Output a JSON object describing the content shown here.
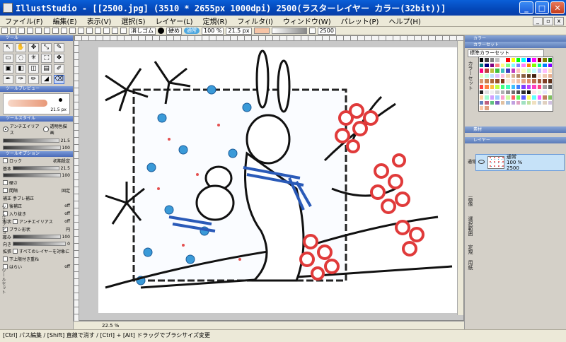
{
  "window": {
    "title": "IllustStudio - [[2500.jpg] (3510 * 2655px 1000dpi)     2500(ラスターレイヤー カラー(32bit))]",
    "minimize": "_",
    "maximize": "□",
    "close": "✕"
  },
  "menu": [
    "ファイル(F)",
    "編集(E)",
    "表示(V)",
    "選択(S)",
    "レイヤー(L)",
    "定規(R)",
    "フィルタ(I)",
    "ウィンドウ(W)",
    "パレット(P)",
    "ヘルプ(H)"
  ],
  "toolbar": {
    "eraser_label": "消しゴム",
    "brush_label": "硬め",
    "mode_pill": "通常",
    "opacity": "100 %",
    "size": "21.5 px",
    "layer_name": "2500"
  },
  "tool_panel": {
    "title": "ツール",
    "tools": [
      "↖",
      "✋",
      "✥",
      "⤡",
      "✎",
      "▭",
      "◌",
      "✳",
      "⬚",
      "❖",
      "▣",
      "◧",
      "◫",
      "▤",
      "✐",
      "✒",
      "✑",
      "✏",
      "◢",
      "⌫"
    ]
  },
  "brush_preview": {
    "title": "ツールプレビュー",
    "size": "21.5 px"
  },
  "tool_style": {
    "title": "ツールスタイル",
    "antialias": "アンチエイリアス",
    "transparent": "透明色描画",
    "value1": "21.5",
    "value2": "100"
  },
  "tool_options": {
    "title": "ツールオプション",
    "lock_label": "ロック",
    "reset_label": "初期設定",
    "size_value": "21.5",
    "opacity_value": "100",
    "hardness_label": "硬さ",
    "interval_label": "間隔",
    "interval_value": "固定",
    "stabilize_label": "手ブレ補正",
    "post_correct_label": "後補正",
    "post_correct_value": "off",
    "fade_label": "入り抜き",
    "fade_value": "off",
    "antialias_label": "アンチエイリアス",
    "antialias_value": "off",
    "brush_shape_label": "ブラシ形状",
    "brush_shape_value": "円",
    "thickness_label": "厚み",
    "thickness_value": "100",
    "direction_label": "向き",
    "direction_value": "0",
    "all_layers_label": "すべてのレイヤーを対象にす...",
    "stack_label": "下上限付き重ね",
    "erase_label": "はらい",
    "erase_value": "off"
  },
  "left_tabs": {
    "tab1": "基本",
    "tab2": "補正",
    "tab3": "形状",
    "tab4": "拡張"
  },
  "side_labels": {
    "options": "ツールオプション",
    "settings": "ツールセット"
  },
  "canvas": {
    "zoom": "22.5 %"
  },
  "color_panel": {
    "title": "カラー"
  },
  "colorset_panel": {
    "title": "カラーセット",
    "selected": "標準カラーセット",
    "side_label": "カラーセット",
    "colors": [
      "#000000",
      "#404040",
      "#808080",
      "#c0c0c0",
      "#ffffff",
      "#ff0000",
      "#ffff00",
      "#00ff00",
      "#00ffff",
      "#0000ff",
      "#ff00ff",
      "#800000",
      "#808000",
      "#008000",
      "#008080",
      "#000080",
      "#800080",
      "#ff8080",
      "#ffff80",
      "#80ff80",
      "#80ffff",
      "#8080ff",
      "#ff80ff",
      "#ff8000",
      "#80ff00",
      "#00ff80",
      "#0080ff",
      "#8000ff",
      "#ff0080",
      "#c04040",
      "#c0c040",
      "#40c040",
      "#40c0c0",
      "#4040c0",
      "#c040c0",
      "#ffc0c0",
      "#ffffc0",
      "#c0ffc0",
      "#c0ffff",
      "#c0c0ff",
      "#ffc0ff",
      "#ffe0c0",
      "#e0ffc0",
      "#c0ffe0",
      "#c0e0ff",
      "#e0c0ff",
      "#ffc0e0",
      "#f0d8b0",
      "#d8b090",
      "#b08860",
      "#886040",
      "#604020",
      "#402010",
      "#f8e0d0",
      "#f0c8b0",
      "#e8b090",
      "#d89870",
      "#c88050",
      "#b06838",
      "#985028",
      "#803818",
      "#fbe8dc",
      "#f7d4c2",
      "#f0c0a8",
      "#e8a888",
      "#e09070",
      "#c07050",
      "#a05838",
      "#804028",
      "#603018",
      "#ff4040",
      "#ff8040",
      "#ffc040",
      "#c0ff40",
      "#40ff80",
      "#40ffc0",
      "#40c0ff",
      "#4080ff",
      "#8040ff",
      "#c040ff",
      "#ff40c0",
      "#ff4080",
      "#a0a0a0",
      "#606060",
      "#202020",
      "#e0e0e0",
      "#f0f0f0",
      "#d0d0d0",
      "#b0b0b0",
      "#909090",
      "#707070",
      "#505050",
      "#303030",
      "#101010",
      "#ffe8e8",
      "#e8ffe8",
      "#e8e8ff",
      "#ffffe8",
      "#ffd0a0",
      "#a0ffd0",
      "#d0a0ff",
      "#a0d0ff",
      "#ffa0d0",
      "#d0ffa0",
      "#ff6060",
      "#60ff60",
      "#6060ff",
      "#ffff60",
      "#60ffff",
      "#ff60ff",
      "#c08060",
      "#80c060",
      "#6080c0",
      "#c06080",
      "#60c080",
      "#8060c0",
      "#e0c0a0",
      "#a0c0e0",
      "#c0a0e0",
      "#e0a0c0",
      "#a0e0c0",
      "#c0e0a0",
      "#f0e0c0",
      "#c0d0e0",
      "#e0d0c0",
      "#d0c0e0",
      "#f8c8a8",
      "#e0a080",
      "#ffffff",
      "#ffffff",
      "#ffffff",
      "#ffffff",
      "#ffffff",
      "#ffffff",
      "#ffffff",
      "#ffffff",
      "#ffffff",
      "#ffffff",
      "#ffffff",
      "#ffffff"
    ]
  },
  "material_panel": {
    "title": "素材"
  },
  "layer_panel": {
    "title": "レイヤー",
    "blend_mode": "通常",
    "opacity": "100",
    "layer_mode": "通常",
    "layer_opacity": "100 %",
    "layer_name": "2500",
    "tabs": [
      "画像",
      "選択範囲",
      "定規",
      "用紙"
    ]
  },
  "status": "[Ctrl] パス編集 / [Shift] 直線で消す / [Ctrl] + [Alt] ドラッグでブラシサイズ変更"
}
